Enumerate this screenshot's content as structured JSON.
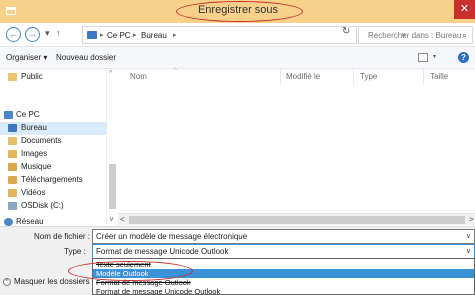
{
  "window": {
    "title": "Enregistrer sous",
    "close_symbol": "✕"
  },
  "nav": {
    "back": "←",
    "forward": "→",
    "history_drop": "▾",
    "up": "↑",
    "breadcrumb": [
      "Ce PC",
      "Bureau"
    ],
    "separator": "▸",
    "addr_drop": "∨",
    "refresh": "↻",
    "search_placeholder": "Rechercher dans : Bureau",
    "search_glyph": "⌕"
  },
  "toolbar": {
    "organize": "Organiser ▾",
    "new_folder": "Nouveau dossier",
    "view_drop": "▾",
    "help": "?"
  },
  "sidebar": {
    "items": [
      {
        "label": "Public",
        "icon": "folder-icon"
      },
      {
        "label": "Ce PC",
        "icon": "computer-icon"
      },
      {
        "label": "Bureau",
        "icon": "desktop-folder-icon",
        "selected": true
      },
      {
        "label": "Documents",
        "icon": "documents-icon"
      },
      {
        "label": "Images",
        "icon": "images-icon"
      },
      {
        "label": "Musique",
        "icon": "music-icon"
      },
      {
        "label": "Téléchargements",
        "icon": "downloads-icon"
      },
      {
        "label": "Vidéos",
        "icon": "videos-icon"
      },
      {
        "label": "OSDisk (C:)",
        "icon": "drive-icon"
      },
      {
        "label": "Réseau",
        "icon": "network-icon"
      }
    ],
    "scroll_up": "^",
    "scroll_down": "∨"
  },
  "filelist": {
    "columns": [
      "Nom",
      "Modifié le",
      "Type",
      "Taille"
    ],
    "sort_glyph": "^",
    "scroll_left": "<",
    "scroll_right": ">"
  },
  "form": {
    "filename_label": "Nom de fichier :",
    "filename_value": "Créer un modèle de message électronique",
    "type_label": "Type :",
    "type_value": "Format de message Unicode Outlook",
    "drop_glyph": "∨",
    "hide_folders_label": "Masquer les dossiers",
    "hide_glyph": "^"
  },
  "type_options": [
    {
      "label": "Texte seulement",
      "state": "struck"
    },
    {
      "label": "Modèle Outlook",
      "state": "highlighted"
    },
    {
      "label": "Format de message Outlook",
      "state": "struck"
    },
    {
      "label": "Format de message Unicode Outlook",
      "state": "normal"
    }
  ],
  "colors": {
    "titlebar": "#f7d08a",
    "close": "#c7302b",
    "selection": "#3a91d8",
    "annotation_circle": "#c92a2a"
  }
}
